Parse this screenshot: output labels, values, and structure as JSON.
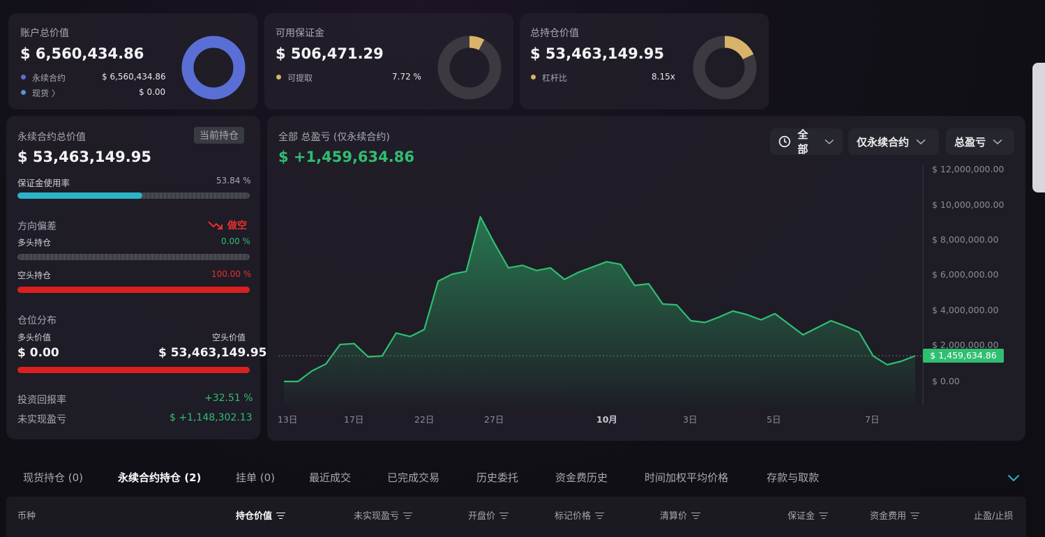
{
  "summary": {
    "account": {
      "title": "账户总价值",
      "value": "$ 6,560,434.86",
      "items": [
        {
          "label": "永续合约",
          "value": "$ 6,560,434.86"
        },
        {
          "label": "现货 〉",
          "value": "$ 0.00"
        }
      ],
      "donut_fraction": 1.0,
      "color": "#5a6fd6"
    },
    "margin": {
      "title": "可用保证金",
      "value": "$ 506,471.29",
      "item_label": "可提取",
      "item_value": "7.72 %",
      "donut_fraction": 0.0772,
      "color": "#d9b36a"
    },
    "position": {
      "title": "总持仓价值",
      "value": "$ 53,463,149.95",
      "item_label": "杠杆比",
      "item_value": "8.15x",
      "donut_fraction": 0.18,
      "color": "#d9b36a"
    }
  },
  "perp": {
    "title": "永续合约总价值",
    "badge": "当前持仓",
    "value": "$ 53,463,149.95",
    "margin_usage_label": "保证金使用率",
    "margin_usage_value": "53.84 %",
    "margin_usage_fraction": 0.5384,
    "direction_label": "方向偏差",
    "direction_value": "做空",
    "long_label": "多头持仓",
    "long_value": "0.00 %",
    "long_fraction": 0,
    "short_label": "空头持仓",
    "short_value": "100.00 %",
    "short_fraction": 1.0,
    "dist_label": "仓位分布",
    "long_value_label": "多头价值",
    "short_value_label": "空头价值",
    "long_amount": "$ 0.00",
    "short_amount": "$ 53,463,149.95",
    "short_dist_fraction": 1.0,
    "roi_label": "投资回报率",
    "roi_value": "+32.51 %",
    "upnl_label": "未实现盈亏",
    "upnl_value": "$ +1,148,302.13"
  },
  "pnl_chart": {
    "title": "全部 总盈亏 (仅永续合约)",
    "value": "$ +1,459,634.86",
    "filters": {
      "range": "全部",
      "scope": "仅永续合约",
      "metric": "总盈亏"
    },
    "current_label": "$ 1,459,634.86"
  },
  "chart_data": {
    "type": "area",
    "x_ticks": [
      "13日",
      "17日",
      "22日",
      "27日",
      "10月",
      "3日",
      "5日",
      "7日"
    ],
    "y_ticks": [
      "$ 12,000,000.00",
      "$ 10,000,000.00",
      "$ 8,000,000.00",
      "$ 6,000,000.00",
      "$ 4,000,000.00",
      "$ 2,000,000.00",
      "$ 0.00"
    ],
    "ylim": [
      0,
      12000000
    ],
    "values": [
      0,
      0,
      600000,
      1000000,
      2100000,
      2150000,
      1400000,
      1450000,
      2750000,
      2550000,
      2950000,
      5700000,
      6100000,
      6250000,
      9350000,
      7850000,
      6450000,
      6600000,
      6300000,
      6450000,
      5800000,
      6200000,
      6500000,
      6800000,
      6650000,
      5450000,
      5550000,
      4400000,
      4350000,
      3450000,
      3350000,
      3650000,
      4000000,
      3800000,
      3500000,
      3850000,
      3250000,
      2650000,
      3050000,
      3450000,
      3150000,
      2800000,
      1450000,
      950000,
      1150000,
      1460000
    ],
    "current_value": 1459634.86,
    "color": "#2fbf71",
    "grid": false
  },
  "tabs": [
    {
      "label": "现货持仓 (0)"
    },
    {
      "label": "永续合约持仓 (2)"
    },
    {
      "label": "挂单 (0)"
    },
    {
      "label": "最近成交"
    },
    {
      "label": "已完成交易"
    },
    {
      "label": "历史委托"
    },
    {
      "label": "资金费历史"
    },
    {
      "label": "时间加权平均价格"
    },
    {
      "label": "存款与取款"
    }
  ],
  "table": {
    "columns": [
      "币种",
      "持仓价值",
      "未实现盈亏",
      "开盘价",
      "标记价格",
      "清算价",
      "保证金",
      "资金费用",
      "止盈/止损"
    ]
  }
}
